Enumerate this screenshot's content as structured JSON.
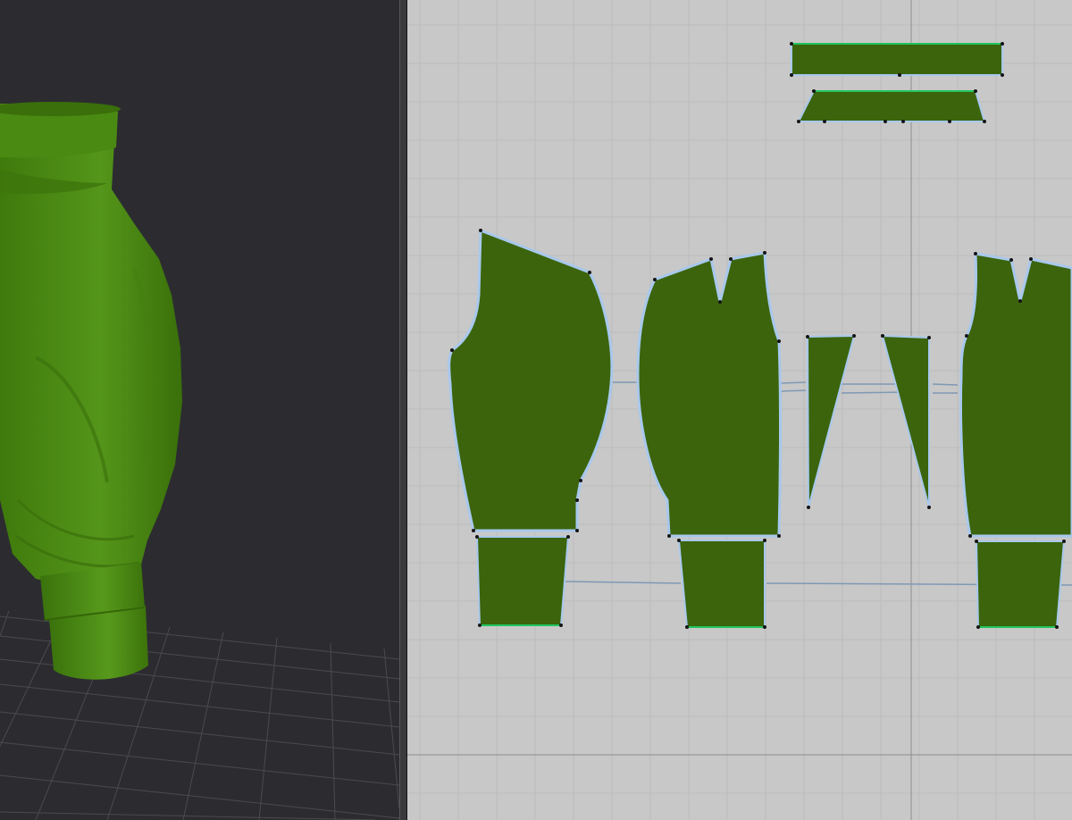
{
  "colors": {
    "viewport_3d_bg": "#2c2c30",
    "floor_grid": "#4a4a4f",
    "garment_3d": "#4e8f14",
    "viewport_2d_bg": "#c8c8c8",
    "grid_minor": "#bcbcbc",
    "grid_major": "#a9a9a9",
    "pattern_fill": "#3b640c",
    "pattern_outline": "#a8c8ec",
    "pattern_edge_selected": "#22c55e",
    "sewing_line": "#7f98b4",
    "point": "#141414"
  },
  "views": {
    "viewport_3d": {
      "icon": "avatar-garment-3d-icon"
    },
    "viewport_2d": {
      "icon": "pattern-pieces-2d-icon"
    }
  }
}
